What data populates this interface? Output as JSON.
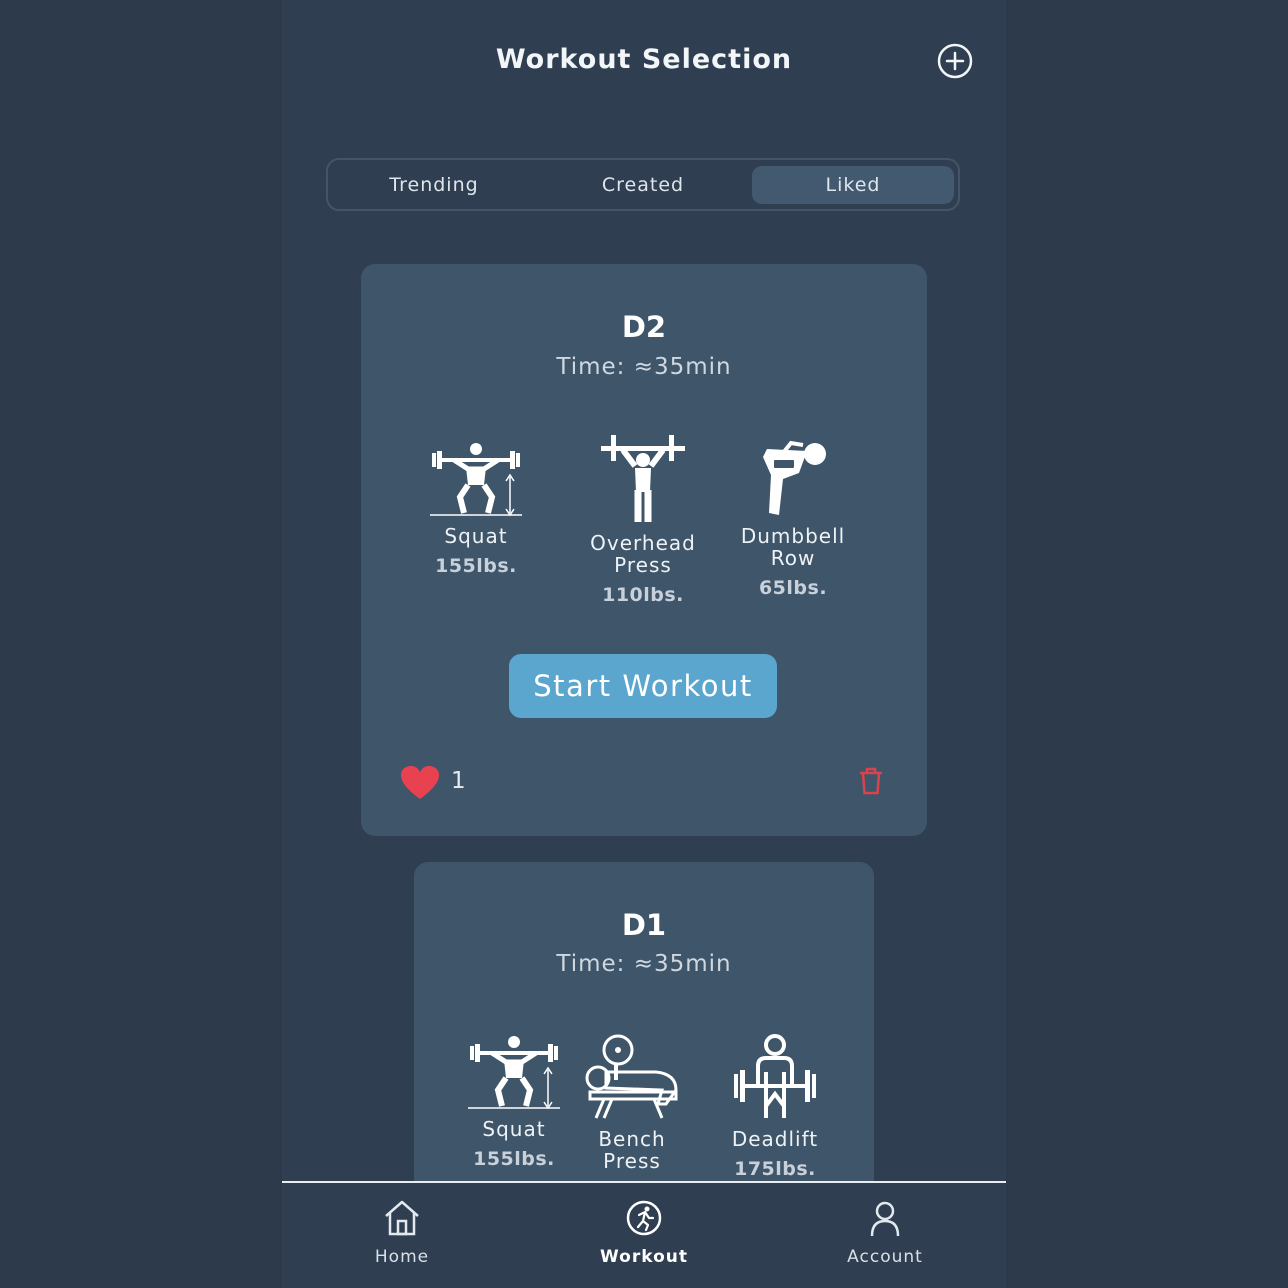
{
  "header": {
    "title": "Workout Selection",
    "add_icon": "plus-circle-icon"
  },
  "segments": {
    "tabs": [
      "Trending",
      "Created",
      "Liked"
    ],
    "selected": "Liked"
  },
  "workouts": [
    {
      "title": "D2",
      "time": "Time: ≈35min",
      "exercises": [
        {
          "name": "Squat",
          "weight": "155lbs.",
          "icon": "squat-icon"
        },
        {
          "name": "Overhead\nPress",
          "weight": "110lbs.",
          "icon": "overhead-press-icon"
        },
        {
          "name": "Dumbbell\nRow",
          "weight": "65lbs.",
          "icon": "dumbbell-row-icon"
        }
      ],
      "start_label": "Start Workout",
      "likes": "1"
    },
    {
      "title": "D1",
      "time": "Time: ≈35min",
      "exercises": [
        {
          "name": "Squat",
          "weight": "155lbs.",
          "icon": "squat-icon"
        },
        {
          "name": "Bench\nPress",
          "weight": "",
          "icon": "bench-press-icon"
        },
        {
          "name": "Deadlift",
          "weight": "175lbs.",
          "icon": "deadlift-icon"
        }
      ]
    }
  ],
  "tabbar": {
    "items": [
      {
        "label": "Home",
        "icon": "home-icon"
      },
      {
        "label": "Workout",
        "icon": "workout-icon"
      },
      {
        "label": "Account",
        "icon": "account-icon"
      }
    ],
    "active": "Workout"
  },
  "colors": {
    "background": "#2c3a4b",
    "card": "#3f5569",
    "accent": "#5aa6cf",
    "like": "#e8414f",
    "delete": "#d9434e"
  }
}
